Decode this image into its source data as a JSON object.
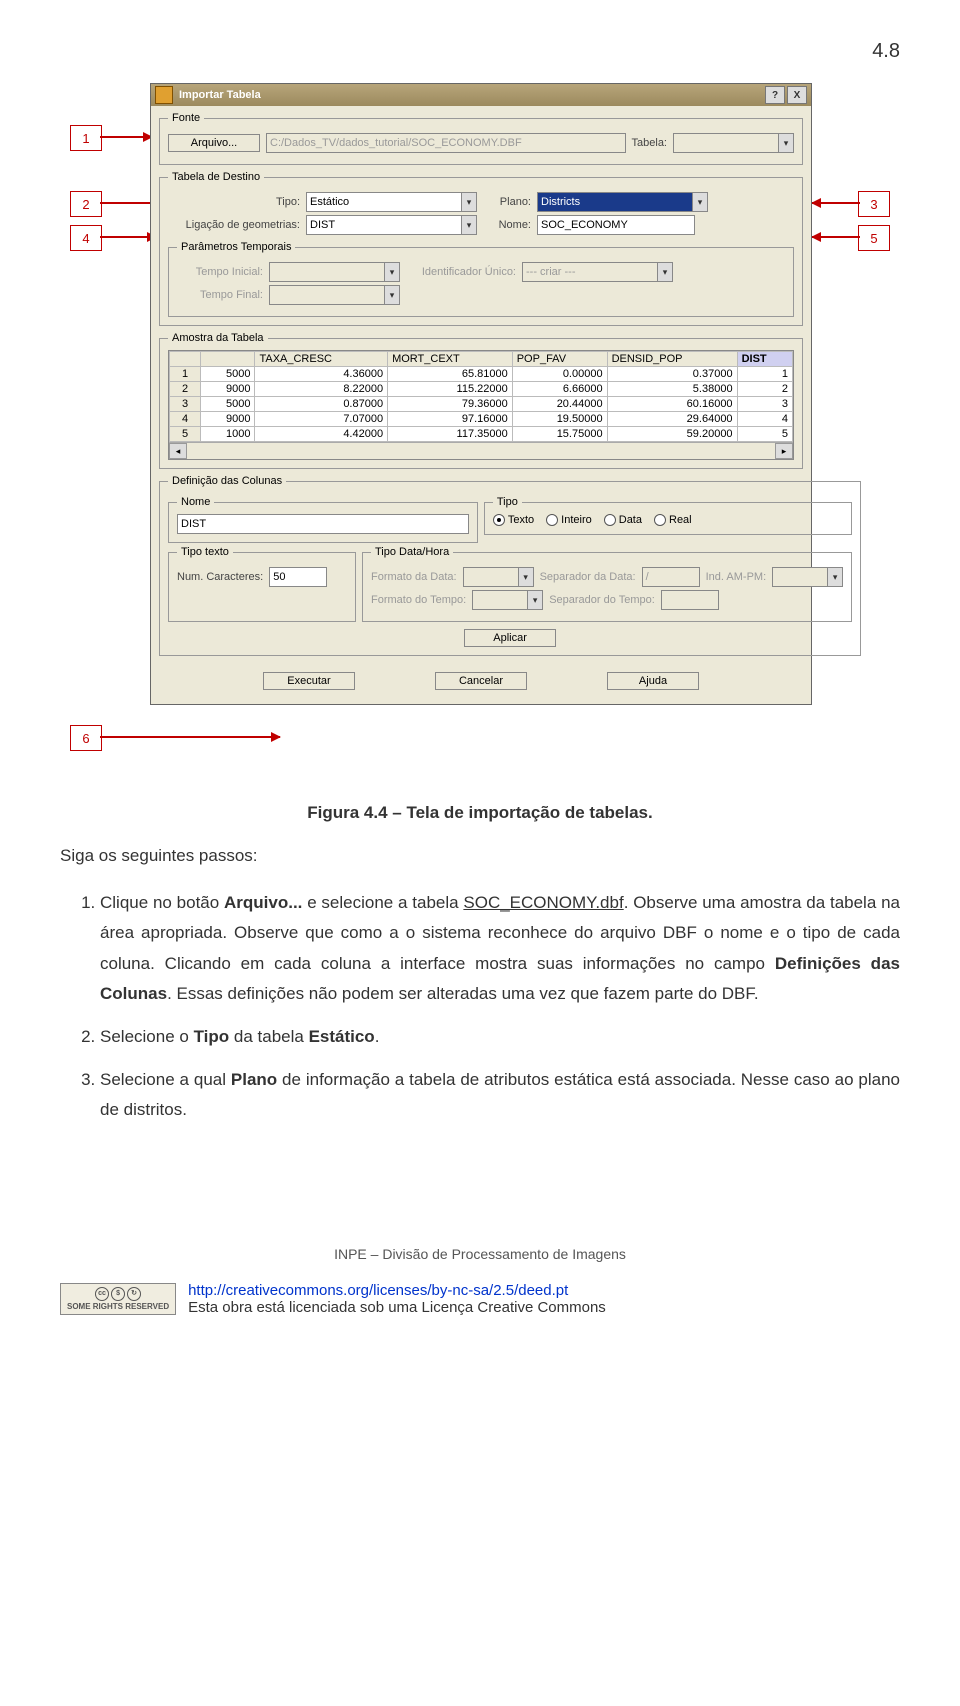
{
  "page_number": "4.8",
  "annotations": {
    "n1": "1",
    "n2": "2",
    "n3": "3",
    "n4": "4",
    "n5": "5",
    "n6": "6"
  },
  "dialog": {
    "title": "Importar Tabela",
    "help_btn": "?",
    "close_btn": "X",
    "fonte": {
      "legend": "Fonte",
      "arquivo_btn": "Arquivo...",
      "arquivo_path": "C:/Dados_TV/dados_tutorial/SOC_ECONOMY.DBF",
      "tabela_label": "Tabela:",
      "tabela_value": ""
    },
    "destino": {
      "legend": "Tabela de Destino",
      "tipo_label": "Tipo:",
      "tipo_value": "Estático",
      "plano_label": "Plano:",
      "plano_value": "Districts",
      "lig_label": "Ligação de geometrias:",
      "lig_value": "DIST",
      "nome_label": "Nome:",
      "nome_value": "SOC_ECONOMY",
      "temporais": {
        "legend": "Parâmetros Temporais",
        "tini_label": "Tempo Inicial:",
        "tfim_label": "Tempo Final:",
        "idu_label": "Identificador Único:",
        "idu_value": "--- criar ---"
      }
    },
    "amostra": {
      "legend": "Amostra da Tabela",
      "headers": [
        "TAXA_CRESC",
        "MORT_CEXT",
        "POP_FAV",
        "DENSID_POP",
        "DIST"
      ],
      "rows": [
        {
          "n": "1",
          "c1": "5000",
          "taxa": "4.36000",
          "mort": "65.81000",
          "pop": "0.00000",
          "dens": "0.37000",
          "dist": "1"
        },
        {
          "n": "2",
          "c1": "9000",
          "taxa": "8.22000",
          "mort": "115.22000",
          "pop": "6.66000",
          "dens": "5.38000",
          "dist": "2"
        },
        {
          "n": "3",
          "c1": "5000",
          "taxa": "0.87000",
          "mort": "79.36000",
          "pop": "20.44000",
          "dens": "60.16000",
          "dist": "3"
        },
        {
          "n": "4",
          "c1": "9000",
          "taxa": "7.07000",
          "mort": "97.16000",
          "pop": "19.50000",
          "dens": "29.64000",
          "dist": "4"
        },
        {
          "n": "5",
          "c1": "1000",
          "taxa": "4.42000",
          "mort": "117.35000",
          "pop": "15.75000",
          "dens": "59.20000",
          "dist": "5"
        }
      ]
    },
    "defcol": {
      "legend": "Definição das Colunas",
      "nome_legend": "Nome",
      "nome_value": "DIST",
      "tipo_legend": "Tipo",
      "radios": {
        "texto": "Texto",
        "inteiro": "Inteiro",
        "data": "Data",
        "real": "Real"
      },
      "tipotexto_legend": "Tipo texto",
      "numcar_label": "Num. Caracteres:",
      "numcar_value": "50",
      "tipodata_legend": "Tipo Data/Hora",
      "formdata_label": "Formato da Data:",
      "sepdata_label": "Separador da Data:",
      "sepdata_value": "/",
      "indampm_label": "Ind. AM-PM:",
      "formtempo_label": "Formato do Tempo:",
      "septempo_label": "Separador do Tempo:"
    },
    "buttons": {
      "aplicar": "Aplicar",
      "executar": "Executar",
      "cancelar": "Cancelar",
      "ajuda": "Ajuda"
    }
  },
  "caption": "Figura 4.4 – Tela de importação de tabelas.",
  "intro": "Siga os seguintes passos:",
  "steps": {
    "s1a": "Clique no botão ",
    "s1b": "Arquivo...",
    "s1c": " e selecione a tabela ",
    "s1d": "SOC_ECONOMY.dbf",
    "s1e": ". Observe uma amostra da tabela na área apropriada. Observe que como a o sistema reconhece do arquivo DBF o nome e o tipo de cada coluna. Clicando em cada coluna a interface mostra suas informações no campo ",
    "s1f": "Definições das Colunas",
    "s1g": ". Essas definições não podem ser alteradas uma vez que fazem parte do DBF.",
    "s2a": "Selecione o ",
    "s2b": "Tipo",
    "s2c": " da tabela ",
    "s2d": "Estático",
    "s2e": ".",
    "s3a": "Selecione a qual ",
    "s3b": "Plano",
    "s3c": " de informação a tabela de atributos estática está associada. Nesse caso ao plano de distritos."
  },
  "footer_inst": "INPE – Divisão de Processamento de Imagens",
  "cc": {
    "badge": "SOME RIGHTS RESERVED",
    "link_url": "http://creativecommons.org/licenses/by-nc-sa/2.5/deed.pt",
    "line2": "Esta obra está licenciada sob uma Licença Creative Commons"
  }
}
